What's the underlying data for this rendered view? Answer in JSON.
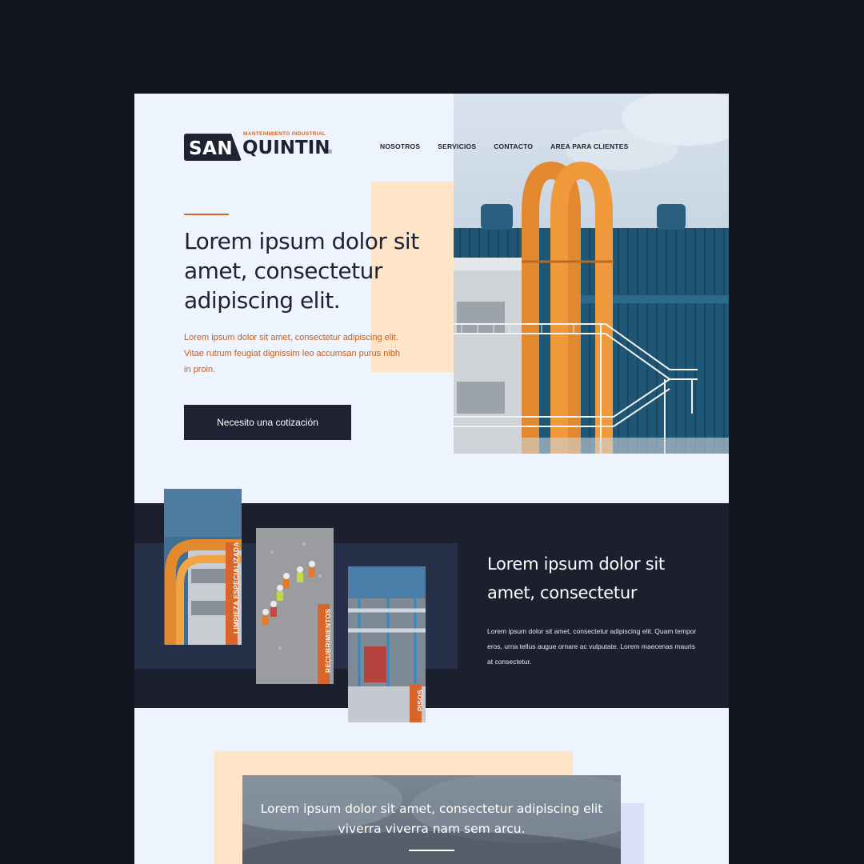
{
  "brand": {
    "name_left": "SAN",
    "name_right": "QUINTIN",
    "tagline": "MANTENIMIENTO INDUSTRIAL",
    "registered": "®"
  },
  "nav": {
    "items": [
      {
        "label": "NOSOTROS"
      },
      {
        "label": "SERVICIOS"
      },
      {
        "label": "CONTACTO"
      },
      {
        "label": "AREA PARA CLIENTES"
      }
    ]
  },
  "hero": {
    "title": "Lorem ipsum dolor sit amet, consectetur adipiscing elit.",
    "text": "Lorem ipsum dolor sit amet, consectetur adipiscing elit. Vitae rutrum feugiat dignissim leo accumsan purus nibh in proin.",
    "cta_label": "Necesito una cotización"
  },
  "services": {
    "cards": [
      {
        "label": "LIMPIEZA ESPECIALIZADA"
      },
      {
        "label": "RECUBRIMIENTOS"
      },
      {
        "label": "PISOS"
      }
    ],
    "title": "Lorem ipsum dolor sit amet, consectetur",
    "text": "Lorem ipsum dolor sit amet, consectetur adipiscing elit. Quam tempor eros, urna tellus augue ornare ac vulputate. Lorem maecenas mauris at consectetur."
  },
  "quote": {
    "text": "Lorem ipsum dolor sit amet, consectetur adipiscing elit viverra viverra nam sem arcu."
  },
  "colors": {
    "page_bg": "#12151f",
    "panel_bg": "#eef4fe",
    "navy": "#1f2233",
    "accent_orange": "#d8662a",
    "peach": "#fee4c9",
    "services_bg": "#1c1f2e",
    "services_band": "#263049"
  }
}
